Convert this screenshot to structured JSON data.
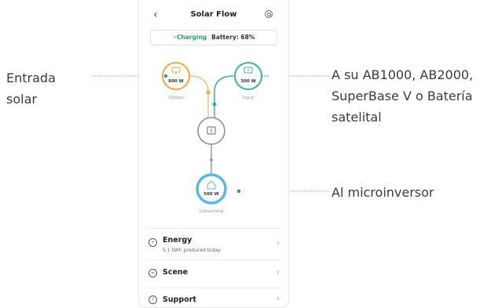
{
  "callouts": {
    "left": [
      "Entrada",
      "solar"
    ],
    "right": [
      "A su AB1000, AB2000,",
      "SuperBase V o Batería",
      "satelital"
    ],
    "bottom": "Al microinversor"
  },
  "app": {
    "title": "Solar Flow",
    "back_icon": "‹",
    "status_charging": "Charging",
    "status_battery": "Battery: 68%"
  },
  "flow": {
    "output": {
      "value": "800 W",
      "label": "Output",
      "icon": "solar-panel-icon"
    },
    "input": {
      "value": "300 W",
      "label": "Input",
      "icon": "battery-icon"
    },
    "center": {
      "icon": "device-icon"
    },
    "consuming": {
      "value": "500 W",
      "label": "Consuming",
      "icon": "home-icon"
    }
  },
  "menu": [
    {
      "label": "Energy",
      "sub": "5.1 kWh produced today",
      "icon": "energy-icon"
    },
    {
      "label": "Scene",
      "icon": "scene-icon"
    },
    {
      "label": "Support",
      "icon": "support-icon"
    }
  ],
  "colors": {
    "solar": "#f4a640",
    "input": "#3cb38a",
    "consuming": "#5ab8e8",
    "accent": "#2a9d6a"
  }
}
